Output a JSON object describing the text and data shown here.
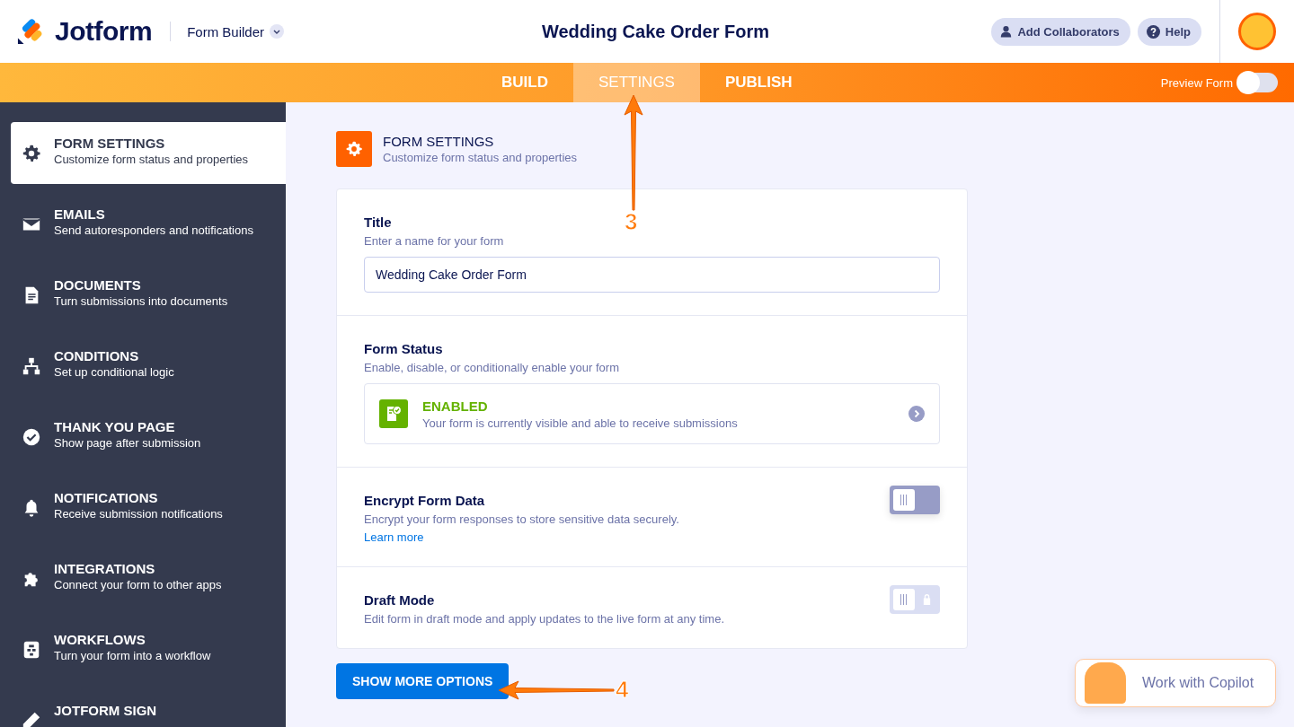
{
  "header": {
    "logo": "Jotform",
    "product": "Form Builder",
    "form_title": "Wedding Cake Order Form",
    "buttons": [
      {
        "kind": "collaborators",
        "label": "Add Collaborators"
      },
      {
        "kind": "help",
        "label": "Help"
      }
    ]
  },
  "tabs": [
    {
      "label": "BUILD",
      "selected": false
    },
    {
      "label": "SETTINGS",
      "selected": true
    },
    {
      "label": "PUBLISH",
      "selected": false
    }
  ],
  "preview": {
    "label": "Preview Form",
    "on": false
  },
  "sidebar": {
    "items": [
      {
        "kind": "gear",
        "title": "FORM SETTINGS",
        "subtitle": "Customize form status and properties",
        "selected": true
      },
      {
        "kind": "mail",
        "title": "EMAILS",
        "subtitle": "Send autoresponders and notifications",
        "selected": false
      },
      {
        "kind": "doc",
        "title": "DOCUMENTS",
        "subtitle": "Turn submissions into documents",
        "selected": false
      },
      {
        "kind": "tree",
        "title": "CONDITIONS",
        "subtitle": "Set up conditional logic",
        "selected": false
      },
      {
        "kind": "check",
        "title": "THANK YOU PAGE",
        "subtitle": "Show page after submission",
        "selected": false
      },
      {
        "kind": "bell",
        "title": "NOTIFICATIONS",
        "subtitle": "Receive submission notifications",
        "selected": false
      },
      {
        "kind": "puzzle",
        "title": "INTEGRATIONS",
        "subtitle": "Connect your form to other apps",
        "selected": false
      },
      {
        "kind": "flow",
        "title": "WORKFLOWS",
        "subtitle": "Turn your form into a workflow",
        "selected": false
      },
      {
        "kind": "sign",
        "title": "JOTFORM SIGN",
        "selected": false
      }
    ]
  },
  "section": {
    "title": "FORM SETTINGS",
    "subtitle": "Customize form status and properties"
  },
  "settings": [
    {
      "kind": "text",
      "title": "Title",
      "description": "Enter a name for your form",
      "value": "Wedding Cake Order Form"
    },
    {
      "kind": "status",
      "title": "Form Status",
      "description": "Enable, disable, or conditionally enable your form",
      "status": "ENABLED",
      "status_text": "Your form is currently visible and able to receive submissions"
    },
    {
      "kind": "toggle",
      "title": "Encrypt Form Data",
      "description": "Encrypt your form responses to store sensitive data securely.",
      "link": "Learn more",
      "on": false
    },
    {
      "kind": "toggle",
      "title": "Draft Mode",
      "description": "Edit form in draft mode and apply updates to the live form at any time.",
      "on": false,
      "locked": true
    }
  ],
  "more_button": "SHOW MORE OPTIONS",
  "copilot": "Work with Copilot",
  "annotations": [
    "3",
    "4"
  ]
}
